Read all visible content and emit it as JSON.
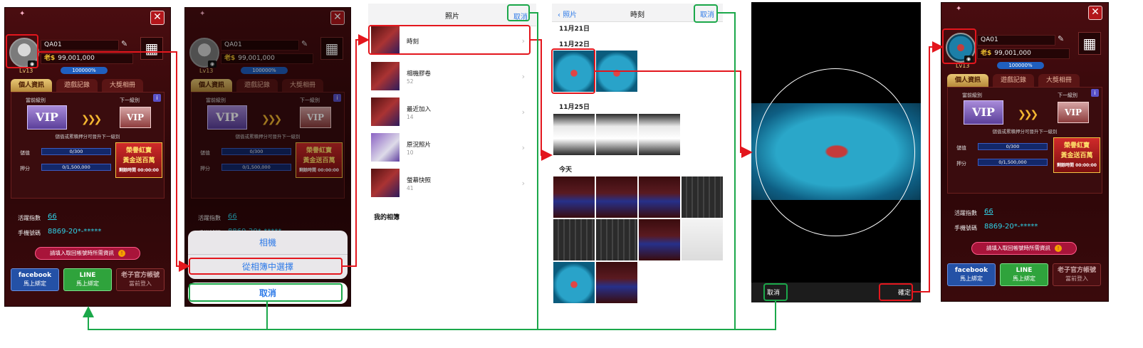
{
  "colors": {
    "highlight_red": "#e3161d",
    "highlight_green": "#1ba84a",
    "ios_blue": "#2f7be8"
  },
  "profile": {
    "username": "QA01",
    "coin_symbol": "老$",
    "coins": "99,001,000",
    "level": "Lv13",
    "level_progress": "100000%",
    "tabs": [
      "個人資訊",
      "遊戲記錄",
      "大獎相冊"
    ],
    "current_level_label": "當前級別",
    "next_level_label": "下一級別",
    "vip_current": "VIP",
    "vip_next": "VIP",
    "upgrade_hint": "儲值或累積押分可晉升下一級別",
    "deposit_label": "儲值",
    "deposit_value": "0/300",
    "bet_label": "押分",
    "bet_value": "0/1,500,000",
    "promo_line1": "榮譽紅寶",
    "promo_line2": "黃金送百萬",
    "promo_time": "剩餘時間 00:00:00",
    "activity_label": "活躍指數",
    "activity_value": "66",
    "phone_label": "手機號碼",
    "phone_value": "8869-20*-*****",
    "prompt_text": "請填入取回帳號時所需資訊",
    "facebook_title": "facebook",
    "facebook_sub": "馬上綁定",
    "line_title": "LINE",
    "line_sub": "馬上綁定",
    "official_title": "老子官方帳號",
    "official_sub": "當前登入"
  },
  "action_sheet": {
    "camera": "相機",
    "choose_album": "從相簿中選擇",
    "cancel": "取消",
    "phone_partial": "8869-20*-*****"
  },
  "photos": {
    "title": "照片",
    "cancel": "取消",
    "albums": [
      {
        "name": "時刻",
        "count": ""
      },
      {
        "name": "相機膠卷",
        "count": "52"
      },
      {
        "name": "最近加入",
        "count": "14"
      },
      {
        "name": "原況照片",
        "count": "10"
      },
      {
        "name": "螢幕快照",
        "count": "41"
      }
    ],
    "my_albums": "我的相簿"
  },
  "moments": {
    "back": "照片",
    "title": "時刻",
    "cancel": "取消",
    "dates": [
      "11月21日",
      "11月22日",
      "11月25日",
      "今天"
    ]
  },
  "crop": {
    "cancel": "取消",
    "confirm": "確定"
  }
}
